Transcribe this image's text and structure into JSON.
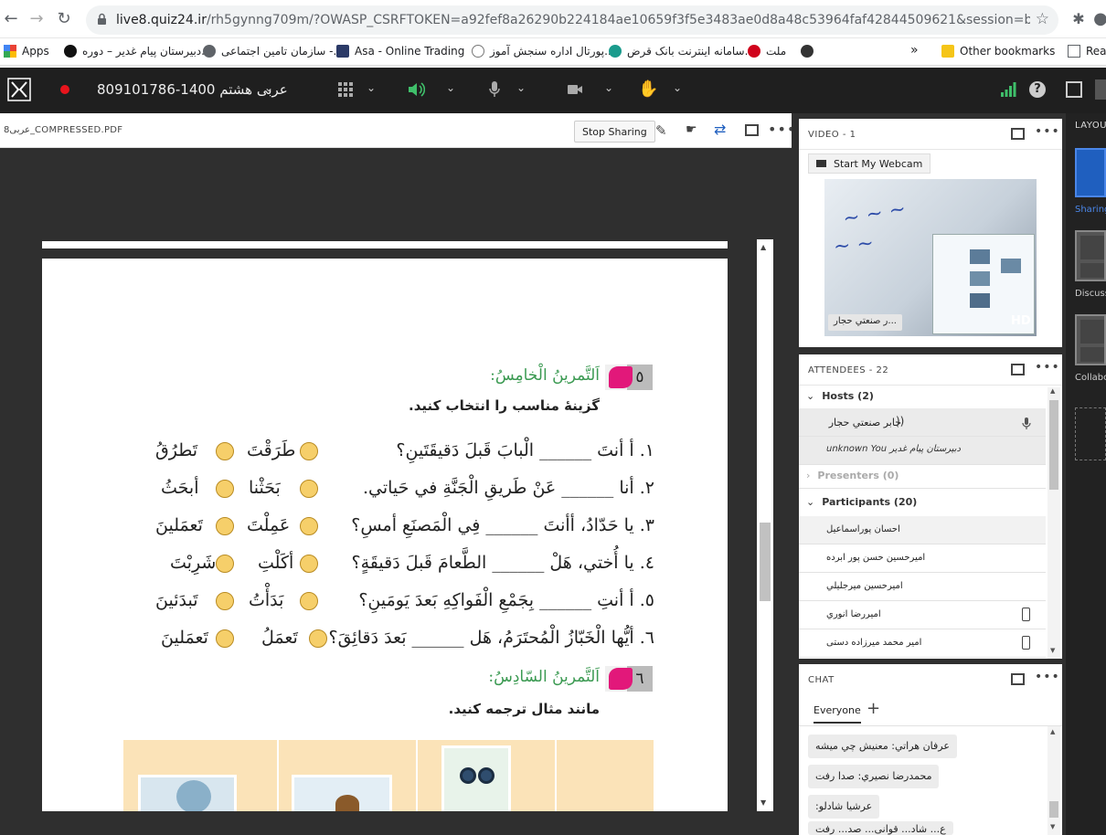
{
  "browser": {
    "url_host": "live8.quiz24.ir",
    "url_rest": "/rh5gynng709m/?OWASP_CSRFTOKEN=a92fef8a26290b224184ae10659f3f5e3483ae0d8a48c53964faf42844509621&session=breezbreezu8cgw4u...",
    "bookmarks": [
      {
        "label": "Apps",
        "color": "#e94235"
      },
      {
        "label": "دبیرستان پیام غدیر – دوره...",
        "color": "#111111"
      },
      {
        "label": "سازمان تامین اجتماعی -...",
        "color": "#5f6368"
      },
      {
        "label": "Asa - Online Trading",
        "color": "#2b3a67"
      },
      {
        "label": "پورتال اداره سنجش آموز...",
        "color": "#777777"
      },
      {
        "label": "سامانه اینترنت بانک قرض...",
        "color": "#1a9b8c"
      },
      {
        "label": "ملت",
        "color": "#d0021b"
      },
      {
        "label": "»",
        "color": ""
      },
      {
        "label": "Other bookmarks",
        "color": "#f5c518"
      },
      {
        "label": "Rea",
        "color": "#5f6368"
      }
    ]
  },
  "appbar": {
    "meeting_title": "809101786-1400 عربی هشتم"
  },
  "share": {
    "filename": "عربی8_COMPRESSED.PDF",
    "stop_sharing": "Stop Sharing"
  },
  "document": {
    "ex5_number": "٥",
    "ex5_title": "اَلتَّمرينُ الْخامِسُ:",
    "ex5_instruction": "گزينهٔ مناسب را انتخاب كنيد.",
    "questions": [
      {
        "q": "١. أ أنتَ ______ الْبابَ قَبلَ دَقيقَتَينِ؟",
        "a": "طَرَقْتَ",
        "b": "تَطرُقُ"
      },
      {
        "q": "٢. أنا ______ عَنْ طَريقِ الْجَنَّةِ في حَياتي.",
        "a": "بَحَثْنا",
        "b": "أبحَثُ"
      },
      {
        "q": "٣. يا حَدّادُ، أأنتَ ______ فِي الْمَصنَعِ أمسِ؟",
        "a": "عَمِلْتَ",
        "b": "تَعمَلينَ"
      },
      {
        "q": "٤. يا أُختي، هَلْ ______ الطَّعامَ قَبلَ دَقيقَةٍ؟",
        "a": "أكَلْتِ",
        "b": "شَرِبْتَ"
      },
      {
        "q": "٥. أ أنتِ ______ بِجَمْعِ الْفَواكِهِ بَعدَ يَومَينِ؟",
        "a": "بَدَأْتُ",
        "b": "تَبدَئينَ"
      },
      {
        "q": "٦. أيُّها الْخَبّازُ الْمُحتَرَمُ، هَل ______ بَعدَ دَقائِقَ؟",
        "a": "تَعمَلُ",
        "b": "تَعمَلينَ"
      }
    ],
    "ex6_number": "٦",
    "ex6_title": "اَلتَّمرينُ السّادِسُ:",
    "ex6_instruction": "مانند مثال ترجمه كنيد."
  },
  "video": {
    "title": "VIDEO - 1",
    "start_webcam": "Start My Webcam",
    "speaker_label": "...ر صنعتي حجار",
    "hd": "HD"
  },
  "attendees": {
    "title": "ATTENDEES - 22",
    "hosts_label": "Hosts (2)",
    "hosts": [
      "جابر صنعتي حجار",
      "دبیرستان پیام غدیر unknown You"
    ],
    "presenters_label": "Presenters (0)",
    "participants_label": "Participants (20)",
    "participants": [
      "احسان پوراسماعيل",
      "اميرحسين حسن پور ابرده",
      "اميرحسين ميرجليلي",
      "اميررضا انوري",
      "امیر محمد میرزاده دستی"
    ]
  },
  "chat": {
    "title": "CHAT",
    "tab": "Everyone",
    "messages": [
      "عرفان هراتي: معنيش چي ميشه",
      "محمدرضا نصيري: صدا رفت",
      "عرشیا شادلو:",
      "ع... شاد... قوانی... صد... رفت"
    ]
  },
  "layouts": {
    "title": "LAYOU",
    "items": [
      "Sharing",
      "Discuss",
      "Collabo"
    ]
  },
  "colors": {
    "ex_green": "#3b9a52",
    "ex_pink": "#e2187a",
    "accent_blue": "#1f5fbf",
    "option_yellow": "#f6cf6a"
  }
}
